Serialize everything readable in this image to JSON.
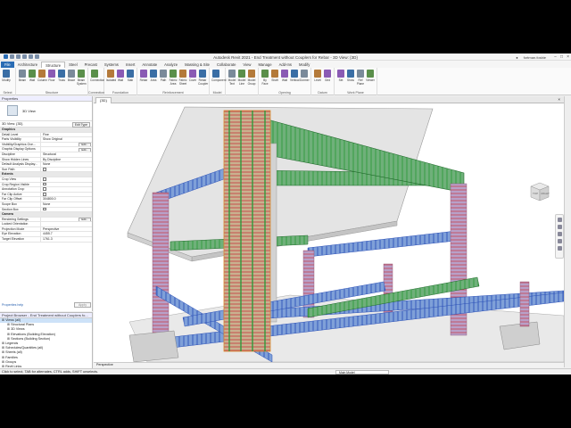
{
  "titlebar": {
    "title": "Autodesk Revit 2021 - End Treatment without Couplers for Rebar - 3D View: {3D}",
    "user": "fortman.fosbie",
    "window_controls": [
      "−",
      "□",
      "×"
    ]
  },
  "menu": {
    "tabs": [
      "File",
      "Architecture",
      "Structure",
      "Steel",
      "Precast",
      "Systems",
      "Insert",
      "Annotate",
      "Analyze",
      "Massing & Site",
      "Collaborate",
      "View",
      "Manage",
      "Add-Ins",
      "Modify"
    ],
    "active_tab": "Structure"
  },
  "ribbon": {
    "groups": [
      {
        "name": "Select",
        "buttons": [
          "Modify"
        ]
      },
      {
        "name": "Structure",
        "buttons": [
          "Beam",
          "Wall",
          "Column",
          "Floor",
          "Truss",
          "Brace",
          "Beam System"
        ]
      },
      {
        "name": "Connection",
        "buttons": [
          "Connection"
        ]
      },
      {
        "name": "Foundation",
        "buttons": [
          "Isolated",
          "Wall",
          "Slab"
        ]
      },
      {
        "name": "Reinforcement",
        "buttons": [
          "Rebar",
          "Area",
          "Path",
          "Fabric Area",
          "Fabric Sheet",
          "Cover",
          "Rebar Coupler"
        ]
      },
      {
        "name": "Model",
        "buttons": [
          "Component"
        ]
      },
      {
        "name": "",
        "buttons": [
          "Model Text",
          "Model Line",
          "Model Group"
        ]
      },
      {
        "name": "Opening",
        "buttons": [
          "By Face",
          "Shaft",
          "Wall",
          "Vertical",
          "Dormer"
        ]
      },
      {
        "name": "Datum",
        "buttons": [
          "Level",
          "Grid"
        ]
      },
      {
        "name": "Work Plane",
        "buttons": [
          "Set",
          "Show",
          "Ref Plane",
          "Viewer"
        ]
      }
    ],
    "colors": [
      "#3a6ea5",
      "#7a8a9a",
      "#5a8f4a",
      "#b47a3a",
      "#8a5ab4"
    ]
  },
  "properties": {
    "header": "Properties",
    "type_name": "3D View",
    "instance_selector": "3D View: {3D}",
    "edit_type": "Edit Type",
    "rows": [
      {
        "section": "Graphics"
      },
      {
        "k": "Detail Level",
        "v": "Fine"
      },
      {
        "k": "Parts Visibility",
        "v": "Show Original"
      },
      {
        "k": "Visibility/Graphics Ove...",
        "v": "",
        "btn": "Edit..."
      },
      {
        "k": "Graphic Display Options",
        "v": "",
        "btn": "Edit..."
      },
      {
        "k": "Discipline",
        "v": "Structural"
      },
      {
        "k": "Show Hidden Lines",
        "v": "By Discipline"
      },
      {
        "k": "Default Analysis Display...",
        "v": "None"
      },
      {
        "k": "Sun Path",
        "v": "",
        "chk": true
      },
      {
        "section": "Extents"
      },
      {
        "k": "Crop View",
        "v": "",
        "chk": true
      },
      {
        "k": "Crop Region Visible",
        "v": "",
        "chk": true
      },
      {
        "k": "Annotation Crop",
        "v": "",
        "chk": true
      },
      {
        "k": "Far Clip Active",
        "v": "",
        "chk": true
      },
      {
        "k": "Far Clip Offset",
        "v": "304800.0"
      },
      {
        "k": "Scope Box",
        "v": "None"
      },
      {
        "k": "Section Box",
        "v": "",
        "chk": true
      },
      {
        "section": "Camera"
      },
      {
        "k": "Rendering Settings",
        "v": "",
        "btn": "Edit..."
      },
      {
        "k": "Locked Orientation",
        "v": ""
      },
      {
        "k": "Projection Mode",
        "v": "Perspective"
      },
      {
        "k": "Eye Elevation",
        "v": "4455.7"
      },
      {
        "k": "Target Elevation",
        "v": "1761.3"
      }
    ],
    "help_link": "Properties help",
    "apply": "Apply"
  },
  "browser": {
    "header": "Project Browser - End Treatment without Couplers fo...",
    "items": [
      {
        "label": "Views (all)",
        "level": 0,
        "sel": true
      },
      {
        "label": "Structural Plans",
        "level": 1
      },
      {
        "label": "3D Views",
        "level": 1
      },
      {
        "label": "Elevations (Building Elevation)",
        "level": 1
      },
      {
        "label": "Sections (Building Section)",
        "level": 1
      },
      {
        "label": "Legends",
        "level": 0
      },
      {
        "label": "Schedules/Quantities (all)",
        "level": 0
      },
      {
        "label": "Sheets (all)",
        "level": 0
      },
      {
        "label": "Families",
        "level": 0
      },
      {
        "label": "Groups",
        "level": 0
      },
      {
        "label": "Revit Links",
        "level": 0
      }
    ]
  },
  "view": {
    "tab_label": "{3D}",
    "close": "×",
    "control_bar": "Perspective",
    "navcube": {
      "face1": "TOP",
      "face2": "RIGHT"
    }
  },
  "status": {
    "text": "Click to select, TAB for alternates, CTRL adds, SHIFT unselects.",
    "model": "Main Model"
  },
  "colors": {
    "concrete": "#d6d6d6",
    "rebar_green": "#2f9a3c",
    "rebar_blue": "#3b64c8",
    "rebar_red": "#c8353b",
    "rebar_orange": "#d98a2f"
  }
}
